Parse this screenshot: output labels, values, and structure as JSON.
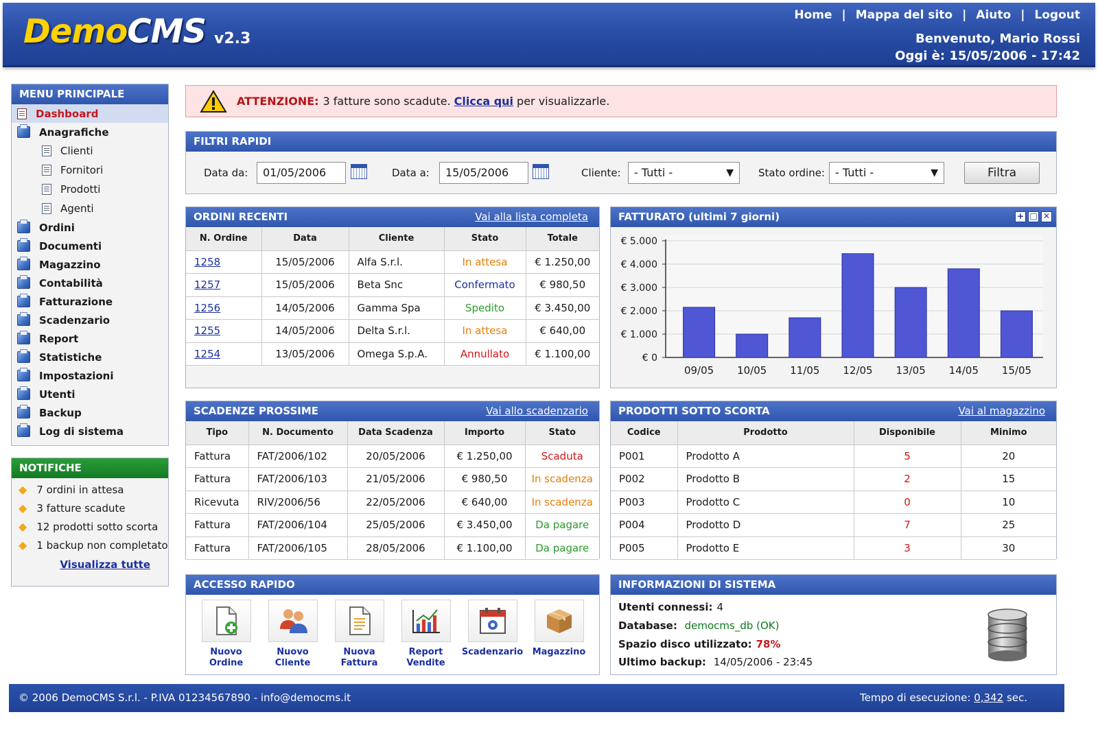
{
  "header": {
    "logo_a": "Demo",
    "logo_b": "CMS",
    "version": "v2.3",
    "nav": [
      "Home",
      "Mappa del sito",
      "Aiuto",
      "Logout"
    ],
    "nav_sep": "|",
    "welcome": "Benvenuto, Mario Rossi",
    "today": "Oggi è: 15/05/2006 - 17:42"
  },
  "menu": {
    "title": "MENU PRINCIPALE",
    "items": [
      {
        "label": "Dashboard",
        "icon": "page-icon",
        "active": true
      },
      {
        "label": "Anagrafiche",
        "icon": "folder-icon"
      },
      {
        "label": "Clienti",
        "icon": "page-icon",
        "sub": true
      },
      {
        "label": "Fornitori",
        "icon": "page-icon",
        "sub": true
      },
      {
        "label": "Prodotti",
        "icon": "page-icon",
        "sub": true
      },
      {
        "label": "Agenti",
        "icon": "page-icon",
        "sub": true
      },
      {
        "label": "Ordini",
        "icon": "folder-icon"
      },
      {
        "label": "Documenti",
        "icon": "folder-icon"
      },
      {
        "label": "Magazzino",
        "icon": "folder-icon"
      },
      {
        "label": "Contabilità",
        "icon": "folder-icon"
      },
      {
        "label": "Fatturazione",
        "icon": "folder-icon"
      },
      {
        "label": "Scadenzario",
        "icon": "folder-icon"
      },
      {
        "label": "Report",
        "icon": "folder-icon"
      },
      {
        "label": "Statistiche",
        "icon": "folder-icon"
      },
      {
        "label": "Impostazioni",
        "icon": "folder-icon"
      },
      {
        "label": "Utenti",
        "icon": "folder-icon"
      },
      {
        "label": "Backup",
        "icon": "folder-icon"
      },
      {
        "label": "Log di sistema",
        "icon": "folder-icon"
      }
    ]
  },
  "notifications": {
    "title": "NOTIFICHE",
    "items": [
      "7 ordini in attesa",
      "3 fatture scadute",
      "12 prodotti sotto scorta",
      "1 backup non completato"
    ],
    "link": "Visualizza tutte"
  },
  "alert": {
    "label": "ATTENZIONE:",
    "text": "3 fatture sono scadute.",
    "link": "Clicca qui",
    "suffix": "per visualizzarle."
  },
  "filters": {
    "title": "FILTRI RAPIDI",
    "date_from_label": "Data da:",
    "date_from": "01/05/2006",
    "date_to_label": "Data a:",
    "date_to": "15/05/2006",
    "client_label": "Cliente:",
    "client_value": "- Tutti -",
    "status_label": "Stato ordine:",
    "status_value": "- Tutti -",
    "button": "Filtra"
  },
  "orders": {
    "title": "ORDINI RECENTI",
    "link": "Vai alla lista completa",
    "columns": [
      "N. Ordine",
      "Data",
      "Cliente",
      "Stato",
      "Totale"
    ],
    "rows": [
      {
        "num": "1258",
        "date": "15/05/2006",
        "client": "Alfa S.r.l.",
        "status": "In attesa",
        "status_color": "#e17f0b",
        "total": "€ 1.250,00"
      },
      {
        "num": "1257",
        "date": "15/05/2006",
        "client": "Beta Snc",
        "status": "Confermato",
        "status_color": "#1a2fa0",
        "total": "€ 980,50"
      },
      {
        "num": "1256",
        "date": "14/05/2006",
        "client": "Gamma Spa",
        "status": "Spedito",
        "status_color": "#2a9b2a",
        "total": "€ 3.450,00"
      },
      {
        "num": "1255",
        "date": "14/05/2006",
        "client": "Delta S.r.l.",
        "status": "In attesa",
        "status_color": "#e17f0b",
        "total": "€ 640,00"
      },
      {
        "num": "1254",
        "date": "13/05/2006",
        "client": "Omega S.p.A.",
        "status": "Annullato",
        "status_color": "#d21414",
        "total": "€ 1.100,00"
      }
    ]
  },
  "revenue": {
    "title": "FATTURATO (ultimi 7 giorni)",
    "buttons": [
      "+",
      "□",
      "✕"
    ]
  },
  "chart_data": {
    "type": "bar",
    "categories": [
      "09/05",
      "10/05",
      "11/05",
      "12/05",
      "13/05",
      "14/05",
      "15/05"
    ],
    "values": [
      2150,
      1000,
      1700,
      4450,
      3000,
      3800,
      2000
    ],
    "yticks": [
      "€ 0",
      "€ 1.000",
      "€ 2.000",
      "€ 3.000",
      "€ 4.000",
      "€ 5.000"
    ],
    "ylim": [
      0,
      5000
    ],
    "bar_color": "#4f57d4",
    "grid": true
  },
  "deadlines": {
    "title": "SCADENZE PROSSIME",
    "link": "Vai allo scadenzario",
    "columns": [
      "Tipo",
      "N. Documento",
      "Data Scadenza",
      "Importo",
      "Stato"
    ],
    "rows": [
      {
        "type": "Fattura",
        "doc": "FAT/2006/102",
        "date": "20/05/2006",
        "amount": "€ 1.250,00",
        "status": "Scaduta",
        "status_color": "#d21414"
      },
      {
        "type": "Fattura",
        "doc": "FAT/2006/103",
        "date": "21/05/2006",
        "amount": "€ 980,50",
        "status": "In scadenza",
        "status_color": "#e17f0b"
      },
      {
        "type": "Ricevuta",
        "doc": "RIV/2006/56",
        "date": "22/05/2006",
        "amount": "€ 640,00",
        "status": "In scadenza",
        "status_color": "#e17f0b"
      },
      {
        "type": "Fattura",
        "doc": "FAT/2006/104",
        "date": "25/05/2006",
        "amount": "€ 3.450,00",
        "status": "Da pagare",
        "status_color": "#2a9b2a"
      },
      {
        "type": "Fattura",
        "doc": "FAT/2006/105",
        "date": "28/05/2006",
        "amount": "€ 1.100,00",
        "status": "Da pagare",
        "status_color": "#2a9b2a"
      }
    ]
  },
  "stock": {
    "title": "PRODOTTI SOTTO SCORTA",
    "link": "Vai al magazzino",
    "columns": [
      "Codice",
      "Prodotto",
      "Disponibile",
      "Minimo"
    ],
    "rows": [
      {
        "code": "P001",
        "product": "Prodotto A",
        "available": "5",
        "min": "20"
      },
      {
        "code": "P002",
        "product": "Prodotto B",
        "available": "2",
        "min": "15"
      },
      {
        "code": "P003",
        "product": "Prodotto C",
        "available": "0",
        "min": "10"
      },
      {
        "code": "P004",
        "product": "Prodotto D",
        "available": "7",
        "min": "25"
      },
      {
        "code": "P005",
        "product": "Prodotto E",
        "available": "3",
        "min": "30"
      }
    ]
  },
  "quick": {
    "title": "ACCESSO RAPIDO",
    "items": [
      {
        "line1": "Nuovo",
        "line2": "Ordine",
        "icon": "new-order-icon"
      },
      {
        "line1": "Nuovo",
        "line2": "Cliente",
        "icon": "new-client-icon"
      },
      {
        "line1": "Nuova",
        "line2": "Fattura",
        "icon": "new-invoice-icon"
      },
      {
        "line1": "Report",
        "line2": "Vendite",
        "icon": "sales-report-icon"
      },
      {
        "line1": "Scadenzario",
        "line2": "",
        "icon": "calendar-icon"
      },
      {
        "line1": "Magazzino",
        "line2": "",
        "icon": "box-icon"
      }
    ]
  },
  "sysinfo": {
    "title": "INFORMAZIONI DI SISTEMA",
    "users_label": "Utenti connessi:",
    "users": "4",
    "db_label": "Database:",
    "db": "democms_db (OK)",
    "disk_label": "Spazio disco utilizzato:",
    "disk": "78%",
    "backup_label": "Ultimo backup:",
    "backup": "14/05/2006 - 23:45"
  },
  "footer": {
    "left": "© 2006 DemoCMS S.r.l. - P.IVA 01234567890 - info@democms.it",
    "time_label": "Tempo di esecuzione:",
    "time": "0,342",
    "time_unit": "sec."
  }
}
